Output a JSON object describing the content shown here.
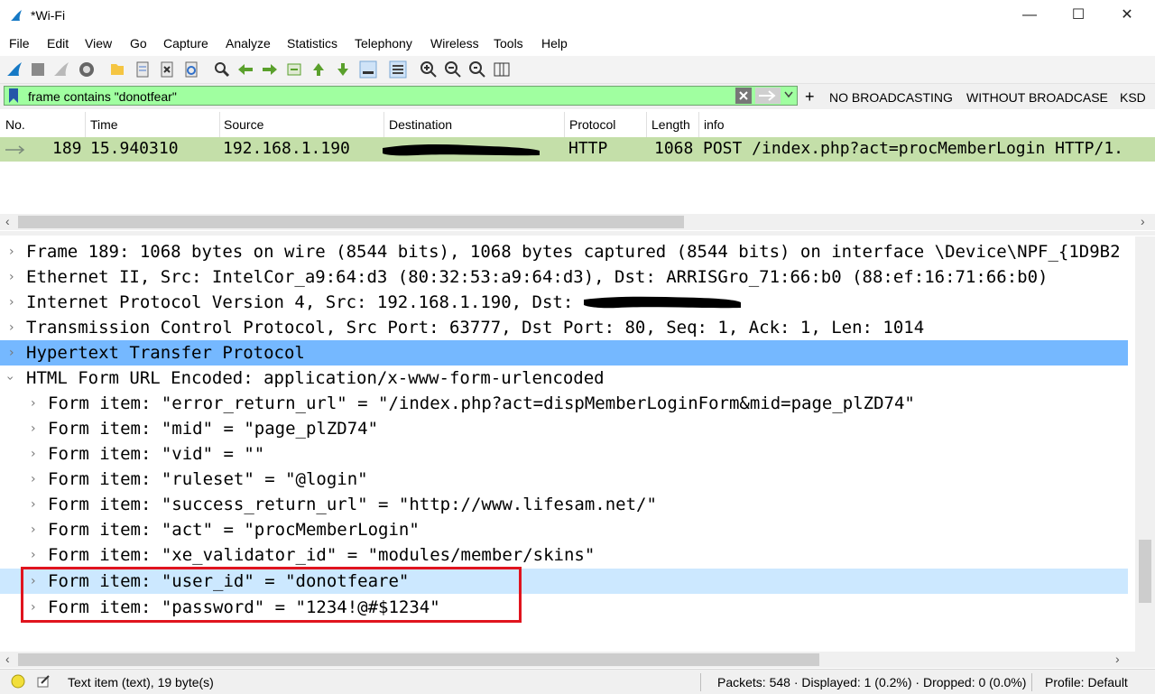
{
  "window": {
    "title": "*Wi-Fi",
    "minimize": "—",
    "maximize": "☐",
    "close": "✕"
  },
  "menu": [
    "File",
    "Edit",
    "View",
    "Go",
    "Capture",
    "Analyze",
    "Statistics",
    "Telephony",
    "Wireless",
    "Tools",
    "Help"
  ],
  "filter": {
    "value": "frame contains \"donotfear\"",
    "buttons": [
      "NO BROADCASTING",
      "WITHOUT BROADCASE",
      "KSD"
    ],
    "add": "+"
  },
  "packet_list": {
    "columns": [
      "No.",
      "Time",
      "Source",
      "Destination",
      "Protocol",
      "Length",
      "info"
    ],
    "row": {
      "no": "189",
      "time": "15.940310",
      "source": "192.168.1.190",
      "destination": "",
      "protocol": "HTTP",
      "length": "1068",
      "info": "POST /index.php?act=procMemberLogin HTTP/1."
    }
  },
  "details": [
    {
      "text": "Frame 189: 1068 bytes on wire (8544 bits), 1068 bytes captured (8544 bits) on interface \\Device\\NPF_{1D9B2",
      "expanded": false
    },
    {
      "text": "Ethernet II, Src: IntelCor_a9:64:d3 (80:32:53:a9:64:d3), Dst: ARRISGro_71:66:b0 (88:ef:16:71:66:b0)",
      "expanded": false
    },
    {
      "text": "Internet Protocol Version 4, Src: 192.168.1.190, Dst:",
      "expanded": false
    },
    {
      "text": "Transmission Control Protocol, Src Port: 63777, Dst Port: 80, Seq: 1, Ack: 1, Len: 1014",
      "expanded": false
    },
    {
      "text": "Hypertext Transfer Protocol",
      "expanded": false
    },
    {
      "text": "HTML Form URL Encoded: application/x-www-form-urlencoded",
      "expanded": true
    },
    {
      "text": "Form item: \"error_return_url\" = \"/index.php?act=dispMemberLoginForm&mid=page_plZD74\"",
      "child": true
    },
    {
      "text": "Form item: \"mid\" = \"page_plZD74\"",
      "child": true
    },
    {
      "text": "Form item: \"vid\" = \"\"",
      "child": true
    },
    {
      "text": "Form item: \"ruleset\" = \"@login\"",
      "child": true
    },
    {
      "text": "Form item: \"success_return_url\" = \"http://www.lifesam.net/\"",
      "child": true
    },
    {
      "text": "Form item: \"act\" = \"procMemberLogin\"",
      "child": true
    },
    {
      "text": "Form item: \"xe_validator_id\" = \"modules/member/skins\"",
      "child": true
    },
    {
      "text": "Form item: \"user_id\" = \"donotfeare\"",
      "child": true
    },
    {
      "text": "Form item: \"password\" = \"1234!@#$1234\"",
      "child": true
    }
  ],
  "status": {
    "item": "Text item (text), 19 byte(s)",
    "packets": "Packets: 548 · Displayed: 1 (0.2%) · Dropped: 0 (0.0%)",
    "profile": "Profile: Default"
  },
  "colors": {
    "filter_ok": "#a0ffa0",
    "selected_row": "#c4dfa9",
    "highlight_blue": "#75b8ff",
    "light_blue": "#cce8ff",
    "redbox": "#e0141e"
  }
}
